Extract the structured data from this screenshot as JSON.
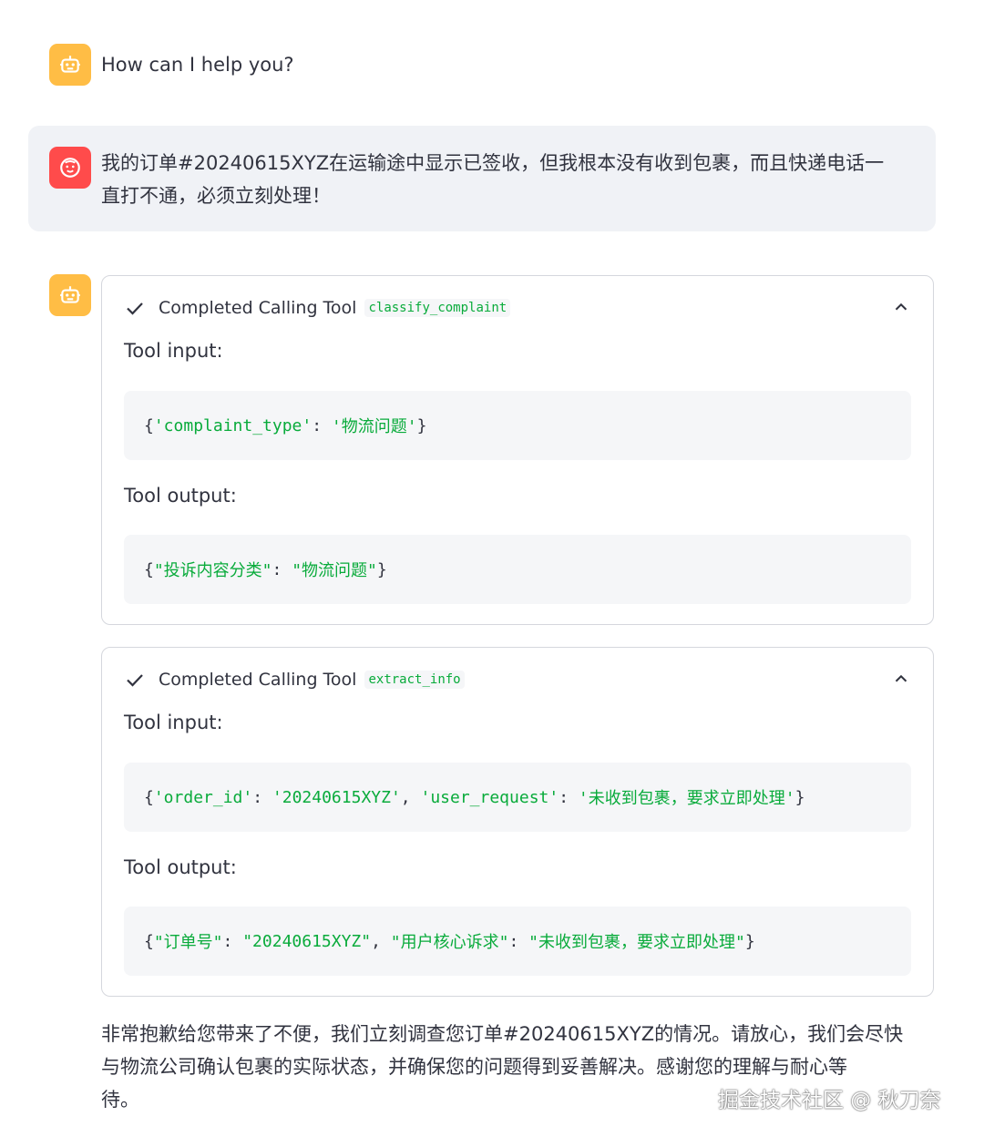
{
  "messages": {
    "assistant_greeting": "How can I help you?",
    "user_message_line1": "我的订单#20240615XYZ在运输途中显示已签收，但我根本没有收到包裹，而且快递电话一",
    "user_message_line2": "直打不通，必须立刻处理！",
    "final_line1": "非常抱歉给您带来了不便，我们立刻调查您订单#20240615XYZ的情况。请放心，我们会尽快",
    "final_line2": "与物流公司确认包裹的实际状态，并确保您的问题得到妥善解决。感谢您的理解与耐心等",
    "final_line3": "待。"
  },
  "tools": [
    {
      "status": "Completed Calling Tool",
      "name": "classify_complaint",
      "input_label": "Tool input:",
      "input": {
        "open": "{",
        "k1": "'complaint_type'",
        "sep1": ": ",
        "v1": "'物流问题'",
        "close": "}"
      },
      "output_label": "Tool output:",
      "output": {
        "open": "{",
        "k1": "\"投诉内容分类\"",
        "sep1": ": ",
        "v1": "\"物流问题\"",
        "close": "}"
      }
    },
    {
      "status": "Completed Calling Tool",
      "name": "extract_info",
      "input_label": "Tool input:",
      "input": {
        "open": "{",
        "k1": "'order_id'",
        "sep1": ": ",
        "v1": "'20240615XYZ'",
        "comma": ", ",
        "k2": "'user_request'",
        "sep2": ": ",
        "v2": "'未收到包裹，要求立即处理'",
        "close": "}"
      },
      "output_label": "Tool output:",
      "output": {
        "open": "{",
        "k1": "\"订单号\"",
        "sep1": ": ",
        "v1": "\"20240615XYZ\"",
        "comma": ", ",
        "k2": "\"用户核心诉求\"",
        "sep2": ": ",
        "v2": "\"未收到包裹，要求立即处理\"",
        "close": "}"
      }
    }
  ],
  "watermark": "掘金技术社区 @ 秋刀奈",
  "colors": {
    "bot_avatar": "#ffbd45",
    "user_avatar": "#ff4b4b",
    "string_green": "#09ab3b"
  },
  "icons": [
    "bot-icon",
    "user-face-icon",
    "check-icon",
    "chevron-up-icon"
  ]
}
